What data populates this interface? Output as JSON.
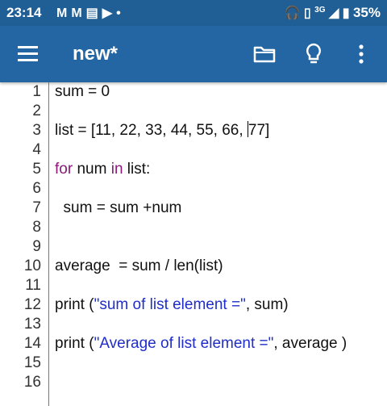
{
  "status_bar": {
    "time": "23:14",
    "notification_icons": [
      "gmail-icon",
      "gmail-icon",
      "news-icon",
      "youtube-icon",
      "dot-icon"
    ],
    "network_label": "3G",
    "battery_percent": "35%"
  },
  "app_bar": {
    "title": "new*",
    "actions": [
      "folder-icon",
      "lightbulb-icon",
      "more-icon"
    ]
  },
  "editor": {
    "cursor": {
      "line": 3,
      "after_text": "list = [11, 22, 33, 44, 55, 66, "
    },
    "lines": [
      {
        "n": "1",
        "text": "sum = 0"
      },
      {
        "n": "2",
        "text": ""
      },
      {
        "n": "3",
        "text": "list = [11, 22, 33, 44, 55, 66, 77]"
      },
      {
        "n": "4",
        "text": ""
      },
      {
        "n": "5",
        "text": "for num in list:"
      },
      {
        "n": "6",
        "text": ""
      },
      {
        "n": "7",
        "text": "  sum = sum +num"
      },
      {
        "n": "8",
        "text": ""
      },
      {
        "n": "9",
        "text": ""
      },
      {
        "n": "10",
        "text": "average  = sum / len(list)"
      },
      {
        "n": "11",
        "text": ""
      },
      {
        "n": "12",
        "text": "print (\"sum of list element =\", sum)"
      },
      {
        "n": "13",
        "text": ""
      },
      {
        "n": "14",
        "text": "print (\"Average of list element =\", average )"
      },
      {
        "n": "15",
        "text": ""
      },
      {
        "n": "16",
        "text": ""
      }
    ]
  }
}
